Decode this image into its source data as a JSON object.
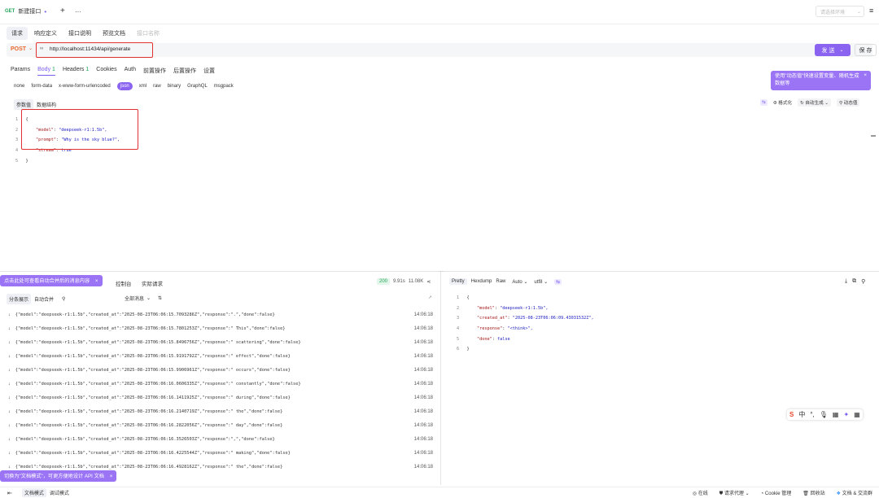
{
  "tab": {
    "method": "GET",
    "title": "新建接口",
    "add": "+",
    "more": "···"
  },
  "env": {
    "placeholder": "请选择环境"
  },
  "subtabs": [
    {
      "label": "请求"
    },
    {
      "label": "响应定义"
    },
    {
      "label": "接口说明"
    },
    {
      "label": "预览文档"
    },
    {
      "label": "接口名称"
    }
  ],
  "url": {
    "method": "POST",
    "value": "http://localhost:11434/api/generate"
  },
  "actions": {
    "send": "发 送",
    "save": "保 存"
  },
  "param_tabs": [
    {
      "label": "Params"
    },
    {
      "label": "Body",
      "count": "1"
    },
    {
      "label": "Headers",
      "count": "1"
    },
    {
      "label": "Cookies"
    },
    {
      "label": "Auth"
    },
    {
      "label": "前置操作"
    },
    {
      "label": "后置操作"
    },
    {
      "label": "设置"
    }
  ],
  "body_types": [
    "none",
    "form-data",
    "x-www-form-urlencoded",
    "json",
    "xml",
    "raw",
    "binary",
    "GraphQL",
    "msgpack"
  ],
  "tip_dynamic": "使用\"动态值\"快速设置变量、随机生成数据等",
  "body_sub": {
    "a": "参数值",
    "b": "数据结构"
  },
  "editor_tools": {
    "format": "格式化",
    "auto": "自动生成",
    "dyn": "动态值"
  },
  "request_code": [
    {
      "n": "1",
      "t": "{"
    },
    {
      "n": "2",
      "k": "\"model\"",
      "v": "\"deepseek-r1:1.5b\","
    },
    {
      "n": "3",
      "k": "\"prompt\"",
      "v": "\"Why is the sky blue?\","
    },
    {
      "n": "4",
      "k": "\"stream\"",
      "v": "true"
    },
    {
      "n": "5",
      "t": "}"
    }
  ],
  "resp_tip": "点击此处可查看自动合并后的消息内容",
  "resp_tabs": {
    "console": "控制台",
    "actual": "实际请求"
  },
  "resp_status": {
    "code": "200",
    "time": "9.91s",
    "size": "11.08K"
  },
  "resp_filters": {
    "split": "分条展示",
    "merge": "自动合并",
    "all": "全部消息"
  },
  "logs": [
    {
      "text": "{\"model\":\"deepseek-r1:1.5b\",\"created_at\":\"2025-08-23T06:06:15.7093286Z\",\"response\":\".\",\"done\":false}",
      "time": "14:06:18"
    },
    {
      "text": "{\"model\":\"deepseek-r1:1.5b\",\"created_at\":\"2025-08-23T06:06:15.7801253Z\",\"response\":\" This\",\"done\":false}",
      "time": "14:06:18"
    },
    {
      "text": "{\"model\":\"deepseek-r1:1.5b\",\"created_at\":\"2025-08-23T06:06:15.8496756Z\",\"response\":\" scattering\",\"done\":false}",
      "time": "14:06:18"
    },
    {
      "text": "{\"model\":\"deepseek-r1:1.5b\",\"created_at\":\"2025-08-23T06:06:15.9191792Z\",\"response\":\" effect\",\"done\":false}",
      "time": "14:06:18"
    },
    {
      "text": "{\"model\":\"deepseek-r1:1.5b\",\"created_at\":\"2025-08-23T06:06:15.9906961Z\",\"response\":\" occurs\",\"done\":false}",
      "time": "14:06:18"
    },
    {
      "text": "{\"model\":\"deepseek-r1:1.5b\",\"created_at\":\"2025-08-23T06:06:16.0606335Z\",\"response\":\" constantly\",\"done\":false}",
      "time": "14:06:18"
    },
    {
      "text": "{\"model\":\"deepseek-r1:1.5b\",\"created_at\":\"2025-08-23T06:06:16.1411925Z\",\"response\":\" during\",\"done\":false}",
      "time": "14:06:18"
    },
    {
      "text": "{\"model\":\"deepseek-r1:1.5b\",\"created_at\":\"2025-08-23T06:06:16.2140719Z\",\"response\":\" the\",\"done\":false}",
      "time": "14:06:18"
    },
    {
      "text": "{\"model\":\"deepseek-r1:1.5b\",\"created_at\":\"2025-08-23T06:06:16.2822056Z\",\"response\":\" day\",\"done\":false}",
      "time": "14:06:18"
    },
    {
      "text": "{\"model\":\"deepseek-r1:1.5b\",\"created_at\":\"2025-08-23T06:06:16.3526503Z\",\"response\":\",\",\"done\":false}",
      "time": "14:06:18"
    },
    {
      "text": "{\"model\":\"deepseek-r1:1.5b\",\"created_at\":\"2025-08-23T06:06:16.4225544Z\",\"response\":\" making\",\"done\":false}",
      "time": "14:06:18"
    },
    {
      "text": "{\"model\":\"deepseek-r1:1.5b\",\"created_at\":\"2025-08-23T06:06:16.4928162Z\",\"response\":\" the\",\"done\":false}",
      "time": "14:06:18"
    }
  ],
  "doc_tip": "切换为\"文档模式\"，可更方便地设计 API 文档",
  "pretty_tabs": {
    "pretty": "Pretty",
    "hexdump": "Hexdump",
    "raw": "Raw",
    "auto": "Auto",
    "enc": "utf8"
  },
  "response_code": [
    {
      "n": "1",
      "t": "{"
    },
    {
      "n": "2",
      "k": "\"model\"",
      "v": "\"deepseek-r1:1.5b\","
    },
    {
      "n": "3",
      "k": "\"created_at\"",
      "v": "\"2025-08-23T06:06:09.43031532Z\","
    },
    {
      "n": "4",
      "k": "\"response\"",
      "v": "\"<think>\","
    },
    {
      "n": "5",
      "k": "\"done\"",
      "v": "false"
    },
    {
      "n": "6",
      "t": "}"
    }
  ],
  "statusbar": {
    "doc_mode": "文档模式",
    "debug_mode": "调试模式",
    "online": "在线",
    "proxy": "请求代理",
    "cookie": "Cookie 管理",
    "recycle": "回收站",
    "community": "文档 & 交流群"
  },
  "ime": {
    "zh": "中"
  },
  "colors": {
    "accent": "#8a63f0",
    "post": "#e8692d",
    "get": "#22a55a",
    "highlight": "#e03030"
  }
}
